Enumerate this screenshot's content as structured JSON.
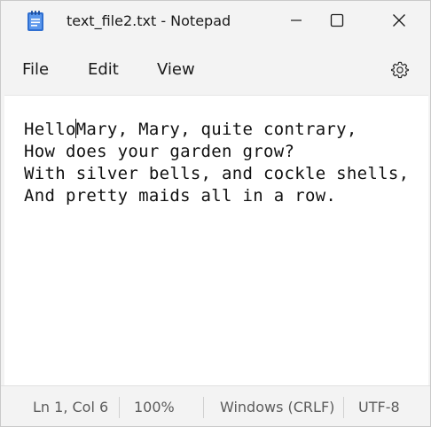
{
  "window": {
    "title": "text_file2.txt - Notepad",
    "app_icon": "notepad-icon"
  },
  "title_buttons": {
    "minimize_icon": "minimize-icon",
    "maximize_icon": "maximize-icon",
    "close_icon": "close-icon"
  },
  "menu": {
    "file": "File",
    "edit": "Edit",
    "view": "View",
    "settings_icon": "gear-icon"
  },
  "editor": {
    "content": "HelloMary, Mary, quite contrary,\nHow does your garden grow?\nWith silver bells, and cockle shells,\nAnd pretty maids all in a row."
  },
  "status": {
    "position": "Ln 1, Col 6",
    "zoom": "100%",
    "line_endings": "Windows (CRLF)",
    "encoding": "UTF-8"
  },
  "colors": {
    "chrome_background": "#f3f3f3",
    "editor_background": "#ffffff",
    "notepad_icon_blue": "#2f6fd1"
  }
}
